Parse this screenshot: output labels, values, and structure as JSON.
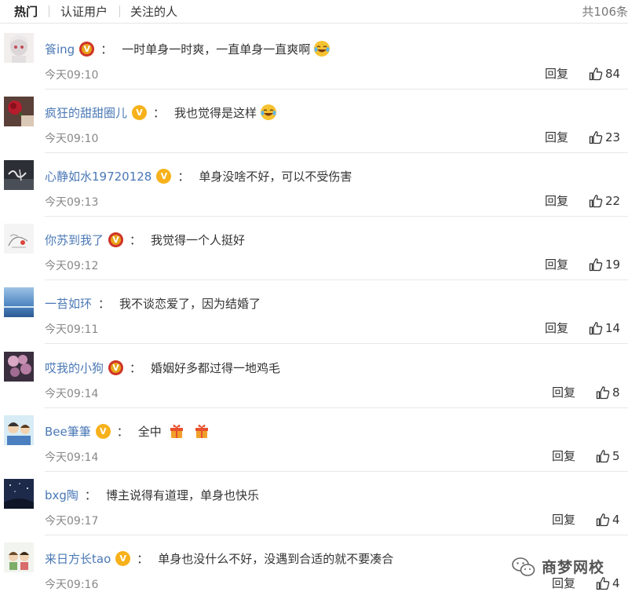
{
  "tabs": [
    {
      "label": "热门",
      "active": true
    },
    {
      "label": "认证用户",
      "active": false
    },
    {
      "label": "关注的人",
      "active": false
    }
  ],
  "total": "共106条",
  "reply_label": "回复",
  "colon": "：",
  "watermark": "商梦网校",
  "colors": {
    "username": "#4a78b5",
    "badge": "#f7b11b",
    "badge_ring": "#d0342c",
    "time": "#888888"
  },
  "comments": [
    {
      "user": "篒ing",
      "badge": "red",
      "text": "一时单身一时爽，一直单身一直爽啊",
      "emoji": "laugh-cry-emoji",
      "time": "今天09:10",
      "likes": "84",
      "avatar": "anime-girl"
    },
    {
      "user": "疯狂的甜甜圈儿",
      "badge": "gold",
      "text": "我也觉得是这样",
      "emoji": "laugh-cry-emoji",
      "time": "今天09:10",
      "likes": "23",
      "avatar": "rose"
    },
    {
      "user": "心静如水19720128",
      "badge": "gold",
      "text": "单身没啥不好，可以不受伤害",
      "emoji": "",
      "time": "今天09:13",
      "likes": "22",
      "avatar": "dark-calligraphy"
    },
    {
      "user": "你苏到我了",
      "badge": "red",
      "text": "我觉得一个人挺好",
      "emoji": "",
      "time": "今天09:12",
      "likes": "19",
      "avatar": "sketch"
    },
    {
      "user": "一苔如环",
      "badge": "",
      "text": "我不谈恋爱了，因为结婚了",
      "emoji": "",
      "time": "今天09:11",
      "likes": "14",
      "avatar": "blue-sky"
    },
    {
      "user": "哎我的小狗",
      "badge": "red",
      "text": "婚姻好多都过得一地鸡毛",
      "emoji": "",
      "time": "今天09:14",
      "likes": "8",
      "avatar": "blossom"
    },
    {
      "user": "Bee筆筆",
      "badge": "gold",
      "text": "全中",
      "emoji": "gift-emoji-x2",
      "time": "今天09:14",
      "likes": "5",
      "avatar": "cartoon"
    },
    {
      "user": "bxg陶",
      "badge": "",
      "text": "博主说得有道理，单身也快乐",
      "emoji": "",
      "time": "今天09:17",
      "likes": "4",
      "avatar": "night-sky"
    },
    {
      "user": "来日方长tao",
      "badge": "gold",
      "text": "单身也没什么不好，没遇到合适的就不要凑合",
      "emoji": "",
      "time": "今天09:16",
      "likes": "4",
      "avatar": "cartoon-kids"
    }
  ]
}
